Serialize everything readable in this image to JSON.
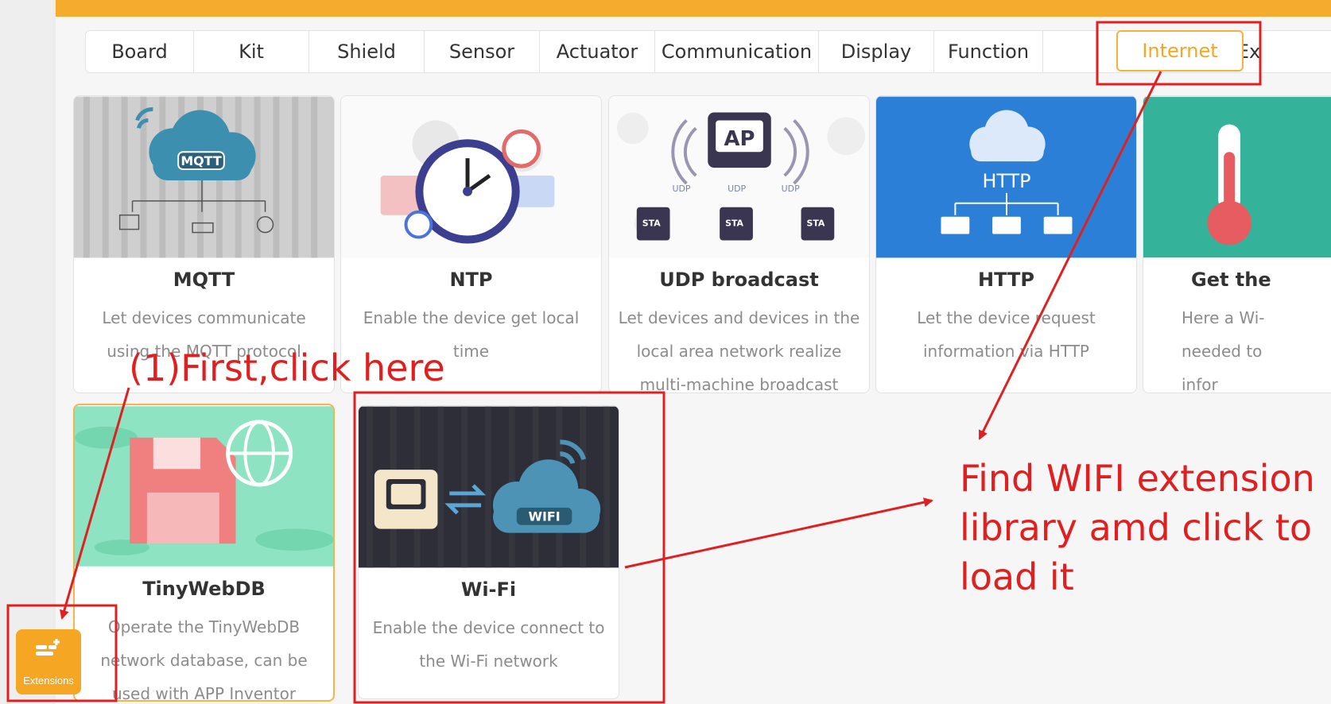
{
  "tabs": [
    {
      "label": "Board"
    },
    {
      "label": "Kit"
    },
    {
      "label": "Shield"
    },
    {
      "label": "Sensor"
    },
    {
      "label": "Actuator"
    },
    {
      "label": "Communication"
    },
    {
      "label": "Display"
    },
    {
      "label": "Function"
    },
    {
      "label": "Internet"
    },
    {
      "label": "User-Ex"
    }
  ],
  "active_tab": "Internet",
  "cards": [
    {
      "title": "MQTT",
      "desc": "Let devices communicate using the MQTT protocol",
      "art_label": "MQTT"
    },
    {
      "title": "NTP",
      "desc": "Enable the device get local time"
    },
    {
      "title": "UDP broadcast",
      "desc": "Let devices and devices in the local area network realize multi-machine broadcast",
      "art_label": "AP",
      "art_tags": [
        "UDP",
        "UDP",
        "UDP",
        "STA",
        "STA",
        "STA"
      ]
    },
    {
      "title": "HTTP",
      "desc": "Let the device request information via HTTP",
      "art_label": "HTTP"
    },
    {
      "title": "Get the",
      "desc": "Here a Wi- needed to infor"
    },
    {
      "title": "TinyWebDB",
      "desc": "Operate the TinyWebDB network database, can be used with APP Inventor"
    },
    {
      "title": "Wi-Fi",
      "desc": "Enable the device connect to the Wi-Fi network",
      "art_label": "WIFI"
    }
  ],
  "annotations": {
    "first_click": "(1)First,click here",
    "find_wifi": "Find WIFI extension library amd click to load it"
  },
  "extensions_button": {
    "label": "Extensions"
  },
  "colors": {
    "accent": "#f5a623",
    "annotation": "#e02020"
  }
}
